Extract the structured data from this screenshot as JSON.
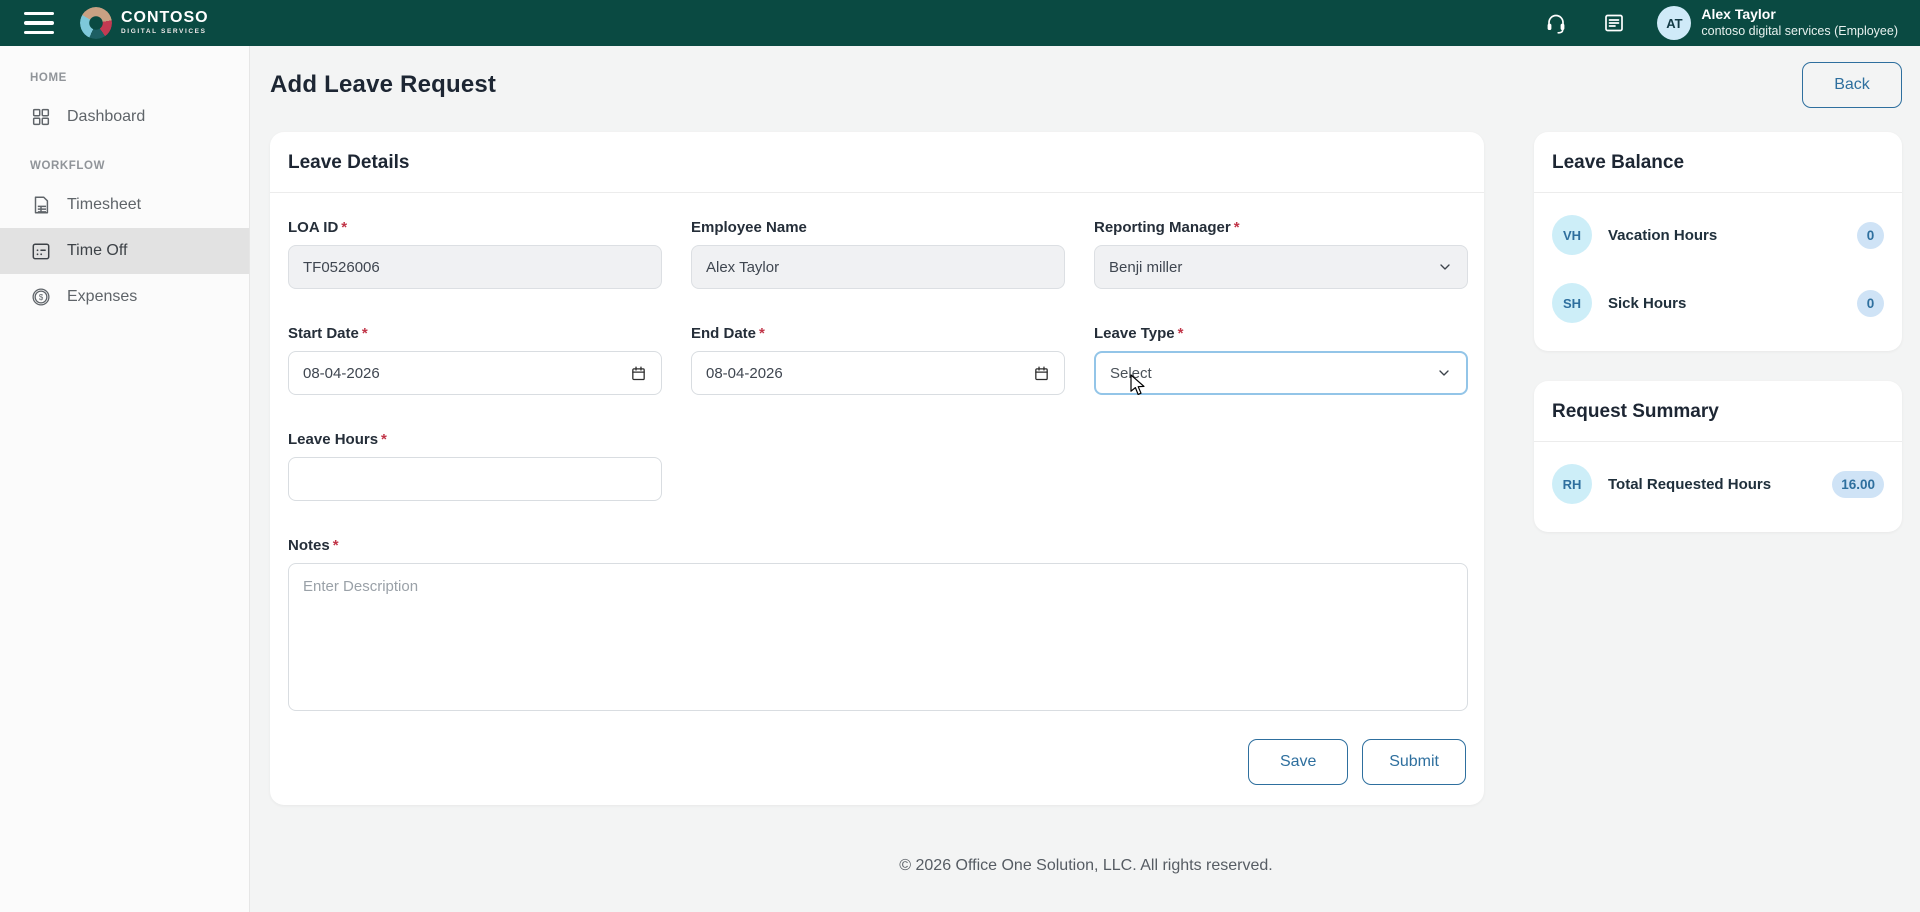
{
  "meta": {
    "required_marker": "*"
  },
  "header": {
    "brand": {
      "name": "CONTOSO",
      "tagline": "DIGITAL SERVICES"
    },
    "user": {
      "initials": "AT",
      "name": "Alex Taylor",
      "role": "contoso digital services (Employee)"
    }
  },
  "sidebar": {
    "sections": [
      {
        "label": "HOME",
        "items": [
          {
            "label": "Dashboard",
            "icon": "dashboard-icon",
            "active": false
          }
        ]
      },
      {
        "label": "WORKFLOW",
        "items": [
          {
            "label": "Timesheet",
            "icon": "timesheet-icon",
            "active": false
          },
          {
            "label": "Time Off",
            "icon": "time-off-icon",
            "active": true
          },
          {
            "label": "Expenses",
            "icon": "expenses-icon",
            "active": false
          }
        ]
      }
    ]
  },
  "page": {
    "title": "Add Leave Request",
    "back_label": "Back"
  },
  "form": {
    "title": "Leave Details",
    "fields": {
      "loa_id": {
        "label": "LOA ID",
        "required": true,
        "value": "TF0526006",
        "disabled": true
      },
      "employee_name": {
        "label": "Employee Name",
        "required": false,
        "value": "Alex Taylor",
        "disabled": true
      },
      "reporting_manager": {
        "label": "Reporting Manager",
        "required": true,
        "value": "Benji miller"
      },
      "start_date": {
        "label": "Start Date",
        "required": true,
        "value": "08-04-2026"
      },
      "end_date": {
        "label": "End Date",
        "required": true,
        "value": "08-04-2026"
      },
      "leave_type": {
        "label": "Leave Type",
        "required": true,
        "value": "Select",
        "focused": true
      },
      "leave_hours": {
        "label": "Leave Hours",
        "required": true,
        "value": ""
      },
      "notes": {
        "label": "Notes",
        "required": true,
        "value": "",
        "placeholder": "Enter Description"
      }
    },
    "actions": {
      "save_label": "Save",
      "submit_label": "Submit"
    }
  },
  "leave_balance": {
    "title": "Leave Balance",
    "items": [
      {
        "initials": "VH",
        "label": "Vacation Hours",
        "value": "0"
      },
      {
        "initials": "SH",
        "label": "Sick Hours",
        "value": "0"
      }
    ]
  },
  "request_summary": {
    "title": "Request Summary",
    "items": [
      {
        "initials": "RH",
        "label": "Total Requested Hours",
        "value": "16.00"
      }
    ]
  },
  "footer": {
    "copyright": "© 2026 Office One Solution, LLC. All rights reserved."
  },
  "colors": {
    "header_bg": "#0a4a42",
    "accent_blue": "#2e6f9e",
    "avatar_bg": "#cfeaf8",
    "chip_cyan_bg": "#cdeef8",
    "badge_blue_bg": "#cfe3f6",
    "required_red": "#c13548",
    "focus_border": "#93c5e8",
    "active_item_bg": "#e2e2e2"
  }
}
